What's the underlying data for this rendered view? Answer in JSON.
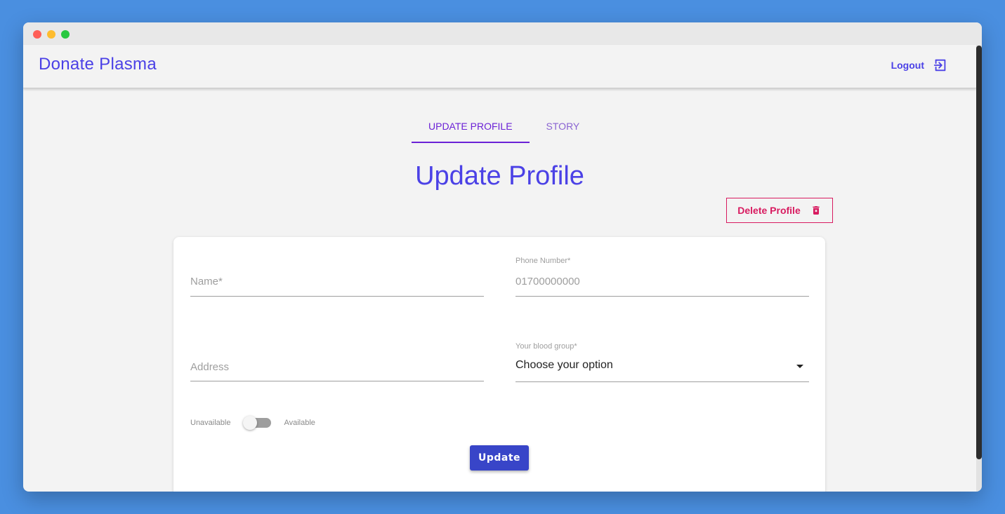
{
  "app": {
    "title": "Donate Plasma"
  },
  "header": {
    "logout_label": "Logout",
    "logout_icon": "logout-icon"
  },
  "tabs": [
    {
      "label": "UPDATE PROFILE",
      "active": true
    },
    {
      "label": "STORY",
      "active": false
    }
  ],
  "page": {
    "title": "Update Profile"
  },
  "delete": {
    "label": "Delete Profile",
    "icon": "trash-icon"
  },
  "form": {
    "name": {
      "placeholder": "Name*",
      "value": ""
    },
    "phone": {
      "label": "Phone Number*",
      "placeholder": "01700000000",
      "value": ""
    },
    "address": {
      "placeholder": "Address",
      "value": ""
    },
    "blood_group": {
      "label": "Your blood group*",
      "selected": "Choose your option"
    },
    "availability": {
      "off_label": "Unavailable",
      "on_label": "Available",
      "checked": false
    },
    "submit_label": "Update"
  },
  "colors": {
    "brand": "#4b41e6",
    "tab_active": "#6b21d6",
    "danger": "#d81b60",
    "button": "#3845c8"
  }
}
